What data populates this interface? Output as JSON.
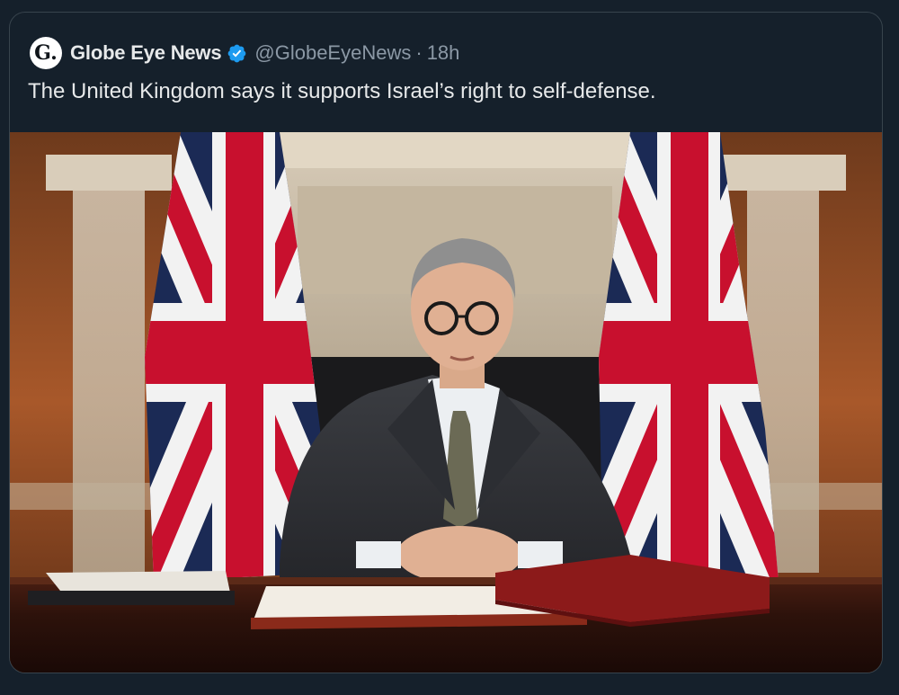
{
  "tweet": {
    "avatar_letter": "G.",
    "display_name": "Globe Eye News",
    "handle": "@GlobeEyeNews",
    "separator": "·",
    "time": "18h",
    "text": "The United Kingdom says it supports Israel’s right to self-defense."
  },
  "colors": {
    "background": "#15202b",
    "verified_blue": "#1d9bf0",
    "text_primary": "#e7e9ea",
    "text_secondary": "#8b98a5"
  },
  "icons": {
    "verified": "verified-badge-icon"
  }
}
